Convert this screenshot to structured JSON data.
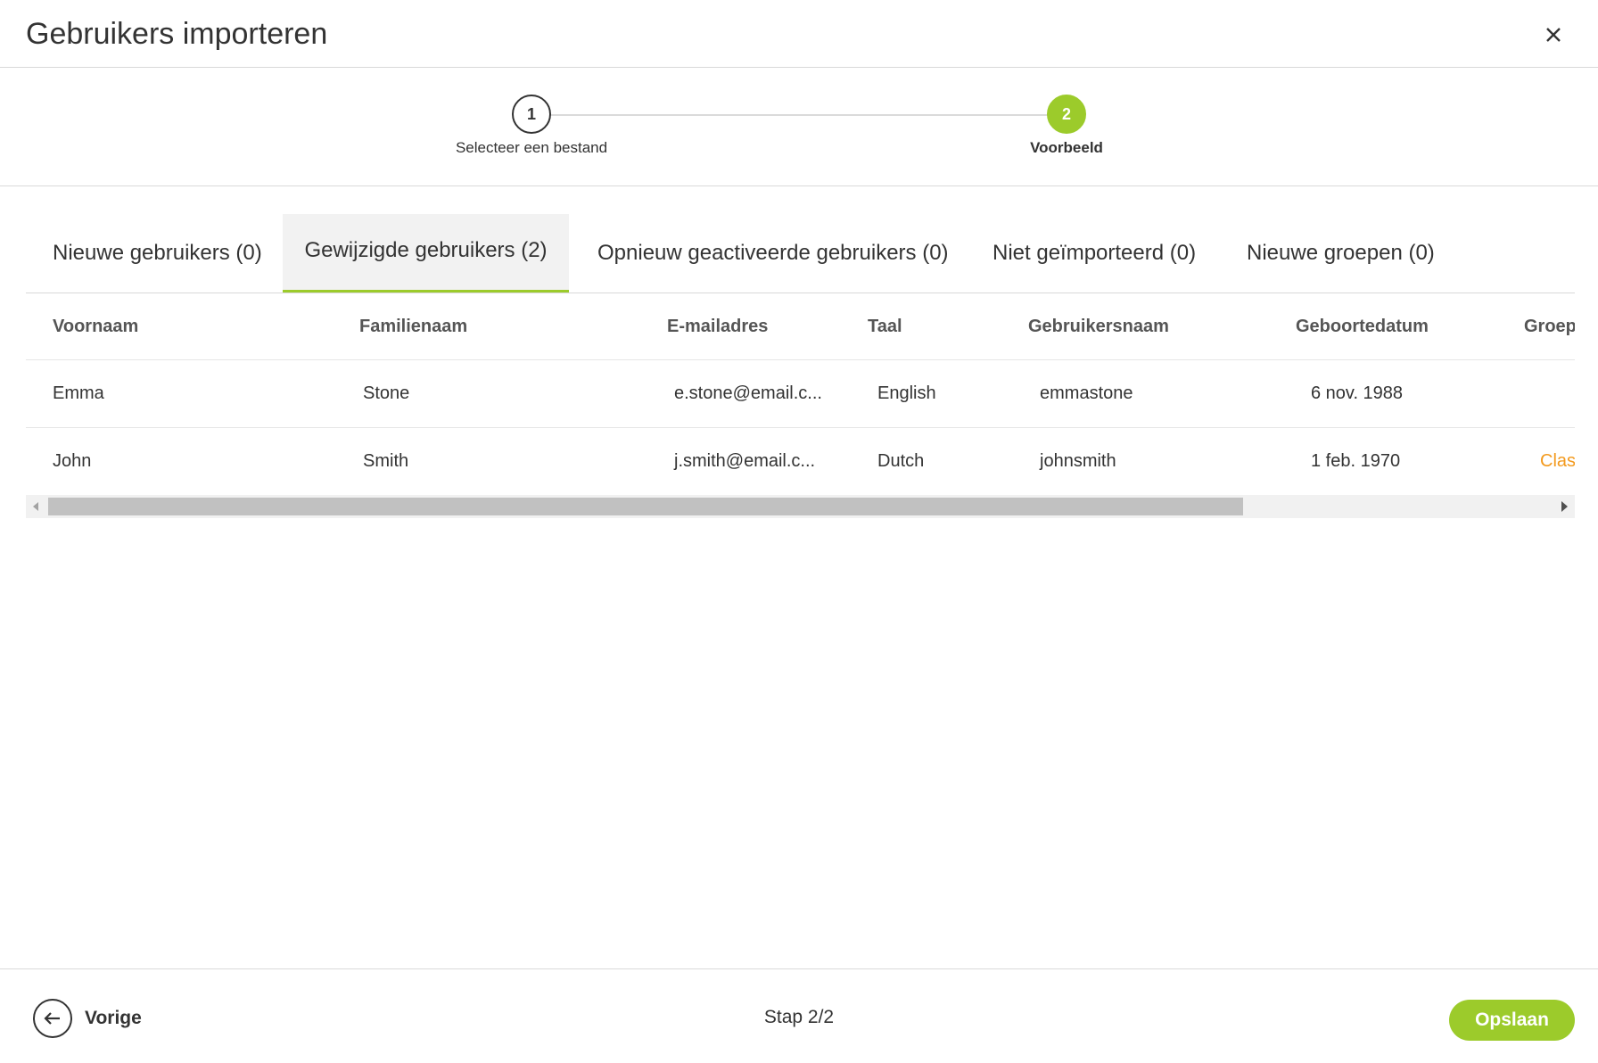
{
  "dialog": {
    "title": "Gebruikers importeren",
    "close_icon": "close-icon"
  },
  "stepper": {
    "steps": [
      {
        "number": "1",
        "label": "Selecteer een bestand",
        "state": "completed"
      },
      {
        "number": "2",
        "label": "Voorbeeld",
        "state": "active"
      }
    ],
    "active_color": "#9ccb2b"
  },
  "tabs": [
    {
      "label": "Nieuwe gebruikers (0)",
      "active": false
    },
    {
      "label": "Gewijzigde gebruikers (2)",
      "active": true
    },
    {
      "label": "Opnieuw geactiveerde gebruikers (0)",
      "active": false
    },
    {
      "label": "Niet geïmporteerd (0)",
      "active": false
    },
    {
      "label": "Nieuwe groepen (0)",
      "active": false
    }
  ],
  "table": {
    "columns": [
      "Voornaam",
      "Familienaam",
      "E-mailadres",
      "Taal",
      "Gebruikersnaam",
      "Geboortedatum",
      "Groep"
    ],
    "rows": [
      {
        "voornaam": "Emma",
        "familienaam": "Stone",
        "email": "e.stone@email.c...",
        "taal": "English",
        "gebruikersnaam": "emmastone",
        "geboortedatum": "6 nov. 1988",
        "groep": ""
      },
      {
        "voornaam": "John",
        "familienaam": "Smith",
        "email": "j.smith@email.c...",
        "taal": "Dutch",
        "gebruikersnaam": "johnsmith",
        "geboortedatum": "1 feb. 1970",
        "groep": "Clas"
      }
    ],
    "link_color": "#f39a1e"
  },
  "footer": {
    "back_label": "Vorige",
    "back_icon": "arrow-left-icon",
    "step_counter": "Stap 2/2",
    "save_label": "Opslaan"
  }
}
